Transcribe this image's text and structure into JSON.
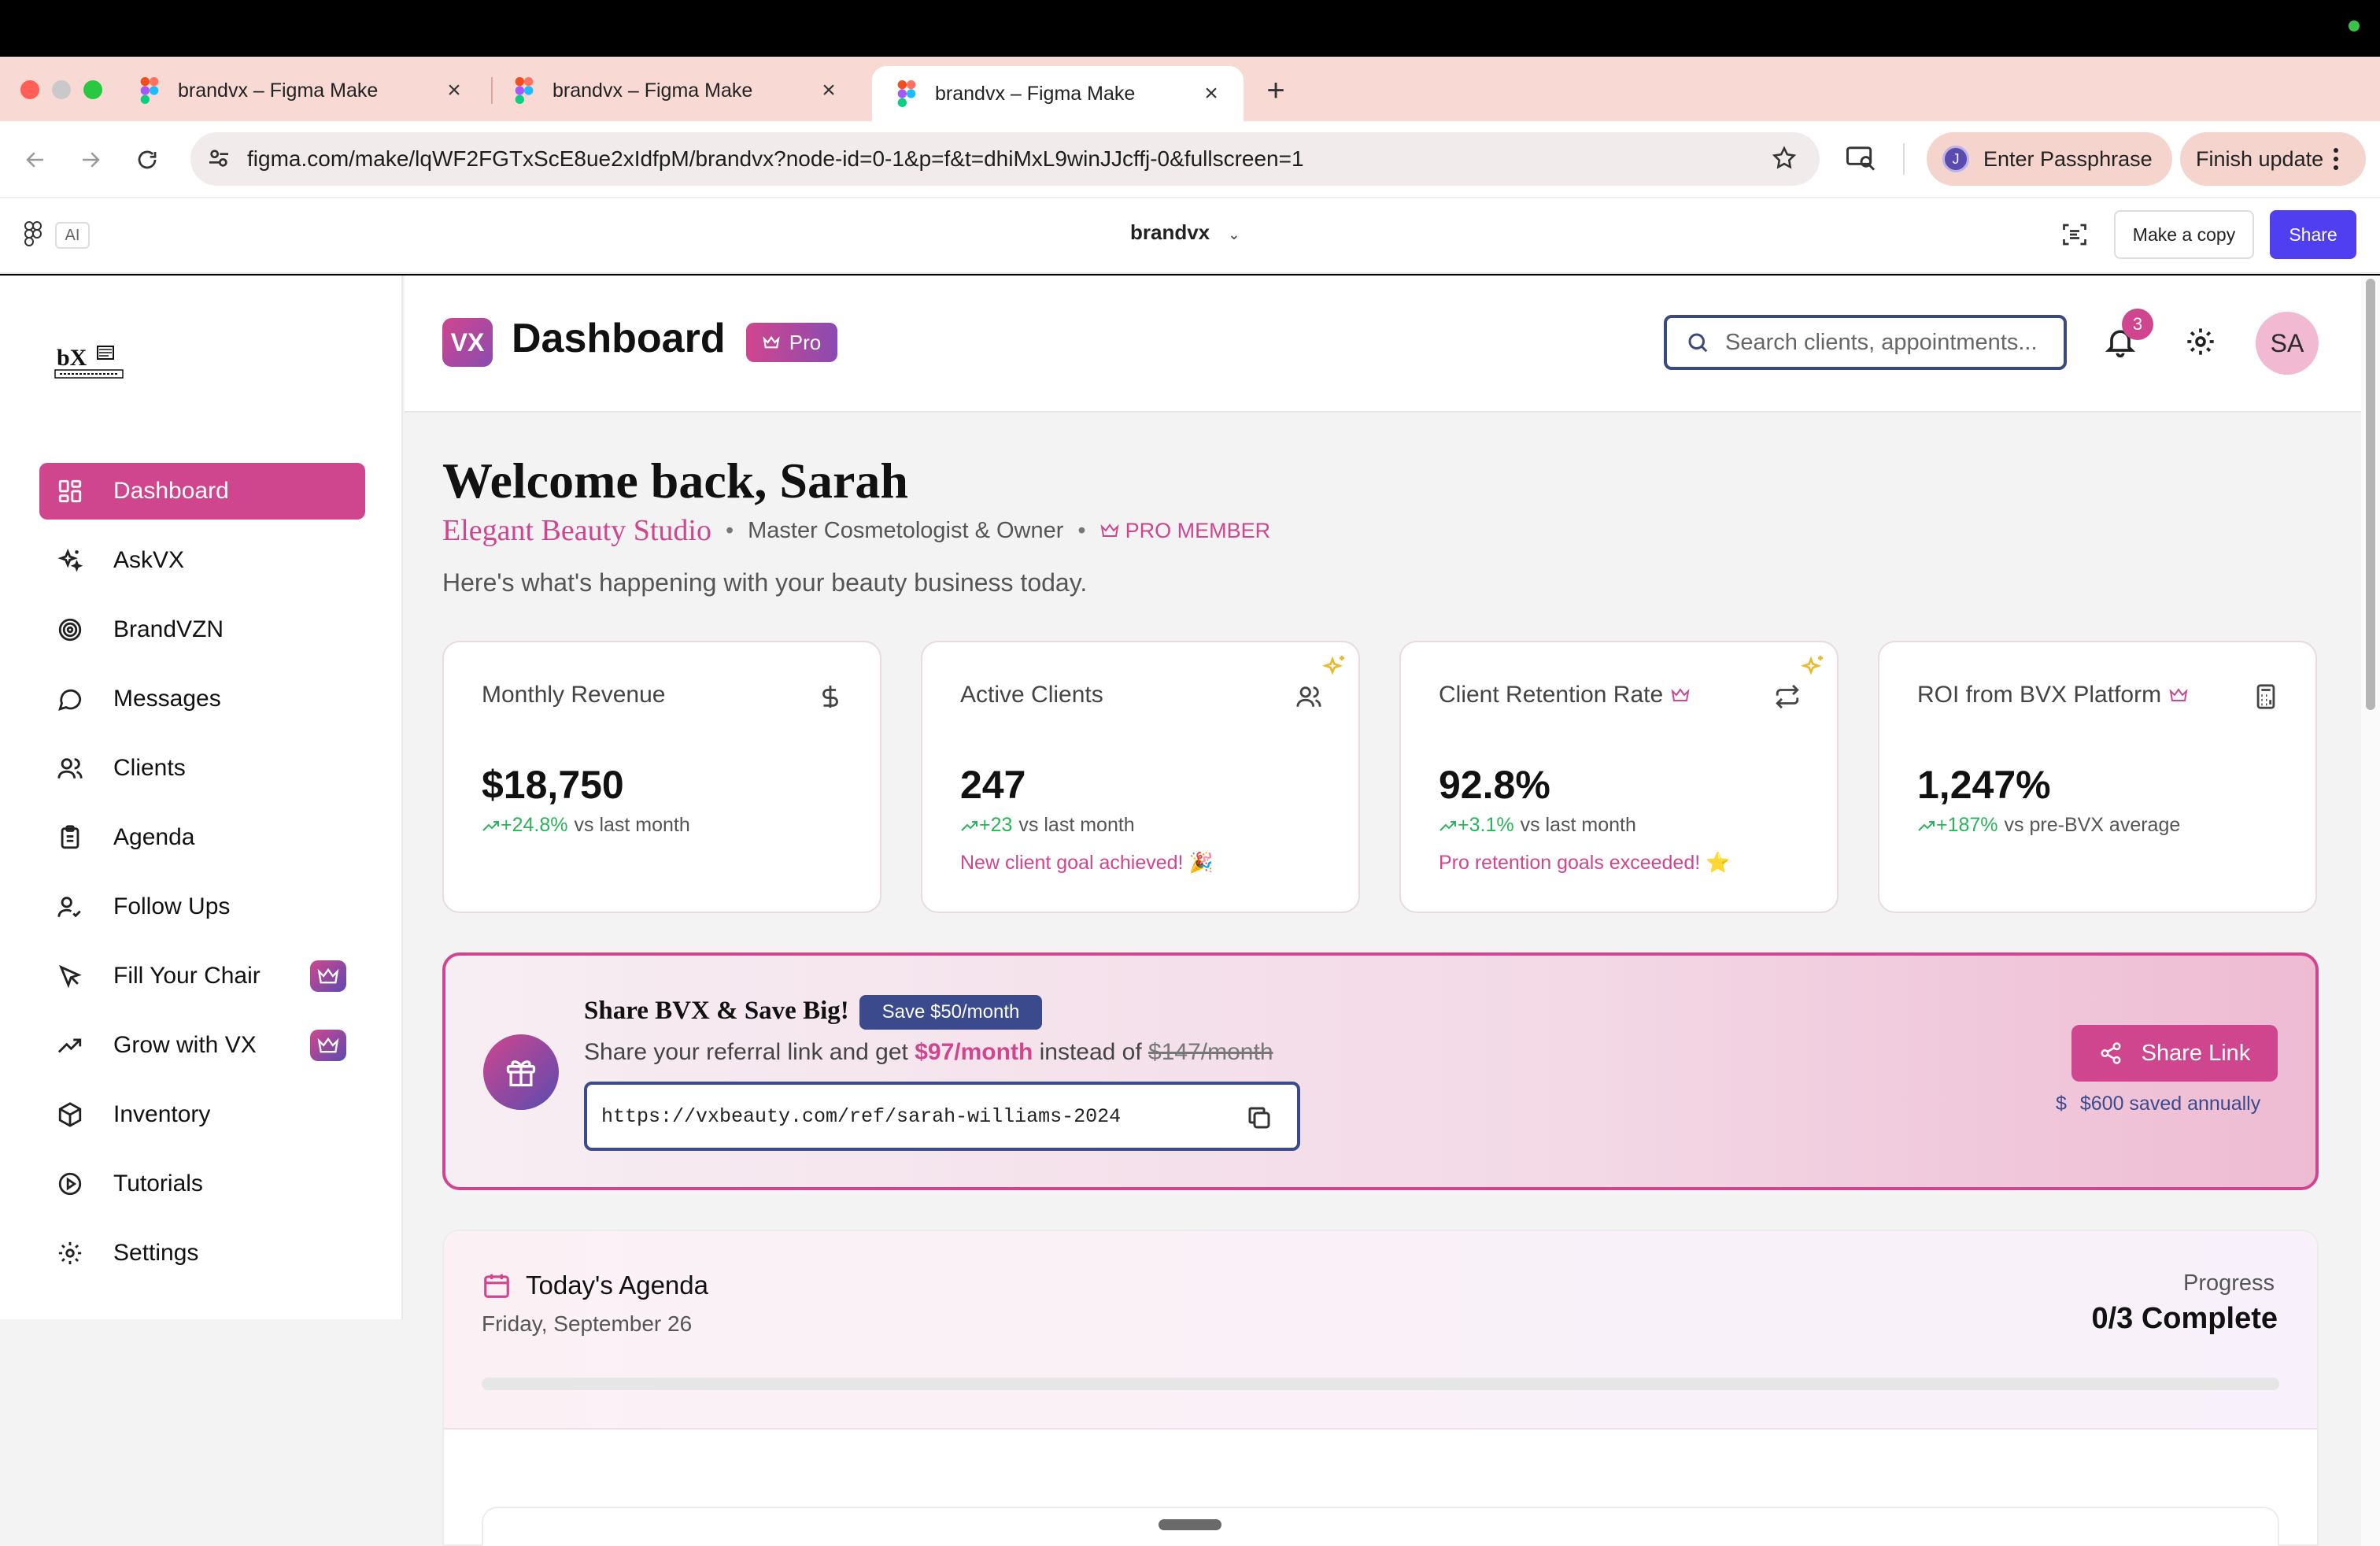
{
  "browser": {
    "tabs": [
      {
        "label": "brandvx – Figma Make",
        "close": "×"
      },
      {
        "label": "brandvx – Figma Make",
        "close": "×"
      },
      {
        "label": "brandvx – Figma Make",
        "close": "×"
      }
    ],
    "new_tab": "+",
    "url": "figma.com/make/lqWF2FGTxScE8ue2xIdfpM/brandvx?node-id=0-1&p=f&t=dhiMxL9winJJcffj-0&fullscreen=1",
    "passphrase_avatar": "J",
    "passphrase_label": "Enter Passphrase",
    "update_label": "Finish update"
  },
  "figma": {
    "ai_badge": "AI",
    "file_title": "brandvx",
    "make_copy": "Make a copy",
    "share": "Share"
  },
  "sidebar": {
    "items": [
      {
        "label": "Dashboard",
        "icon": "dashboard-grid-icon"
      },
      {
        "label": "AskVX",
        "icon": "sparkles-icon"
      },
      {
        "label": "BrandVZN",
        "icon": "target-icon"
      },
      {
        "label": "Messages",
        "icon": "message-icon"
      },
      {
        "label": "Clients",
        "icon": "users-icon"
      },
      {
        "label": "Agenda",
        "icon": "clipboard-icon"
      },
      {
        "label": "Follow Ups",
        "icon": "user-check-icon"
      },
      {
        "label": "Fill Your Chair",
        "icon": "cursor-icon"
      },
      {
        "label": "Grow with VX",
        "icon": "trending-up-icon"
      },
      {
        "label": "Inventory",
        "icon": "package-icon"
      },
      {
        "label": "Tutorials",
        "icon": "play-circle-icon"
      },
      {
        "label": "Settings",
        "icon": "gear-icon"
      }
    ]
  },
  "header": {
    "logo": "VX",
    "title": "Dashboard",
    "pro_badge": "Pro",
    "search_placeholder": "Search clients, appointments...",
    "notification_count": "3",
    "avatar_initials": "SA"
  },
  "welcome": {
    "greeting": "Welcome back, Sarah",
    "studio": "Elegant Beauty Studio",
    "role": "Master Cosmetologist & Owner",
    "member": "PRO MEMBER",
    "subtitle": "Here's what's happening with your beauty business today.",
    "separator": "•"
  },
  "stats": [
    {
      "title": "Monthly Revenue",
      "value": "$18,750",
      "delta": "+24.8%",
      "delta_suffix": "vs last month",
      "note": ""
    },
    {
      "title": "Active Clients",
      "value": "247",
      "delta": "+23",
      "delta_suffix": "vs last month",
      "note": "New client goal achieved! 🎉"
    },
    {
      "title": "Client Retention Rate",
      "value": "92.8%",
      "delta": "+3.1%",
      "delta_suffix": "vs last month",
      "note": "Pro retention goals exceeded! ⭐"
    },
    {
      "title": "ROI from BVX Platform",
      "value": "1,247%",
      "delta": "+187%",
      "delta_suffix": "vs pre-BVX average",
      "note": ""
    }
  ],
  "referral": {
    "title": "Share BVX & Save Big!",
    "save_badge": "Save $50/month",
    "desc_prefix": "Share your referral link and get",
    "price_new": "$97/month",
    "desc_mid": "instead of",
    "price_old": "$147/month",
    "url": "https://vxbeauty.com/ref/sarah-williams-2024",
    "share_button": "Share Link",
    "saved": "$600 saved annually"
  },
  "agenda": {
    "title": "Today's Agenda",
    "date": "Friday, September 26",
    "progress_label": "Progress",
    "progress_value": "0/3 Complete",
    "progress_fraction": 0
  },
  "colors": {
    "brand_pink": "#d0468e",
    "brand_purple": "#5b4bb0",
    "navy": "#3a4a8c",
    "positive": "#2bb35a",
    "figma_blue": "#4f3ff0"
  }
}
